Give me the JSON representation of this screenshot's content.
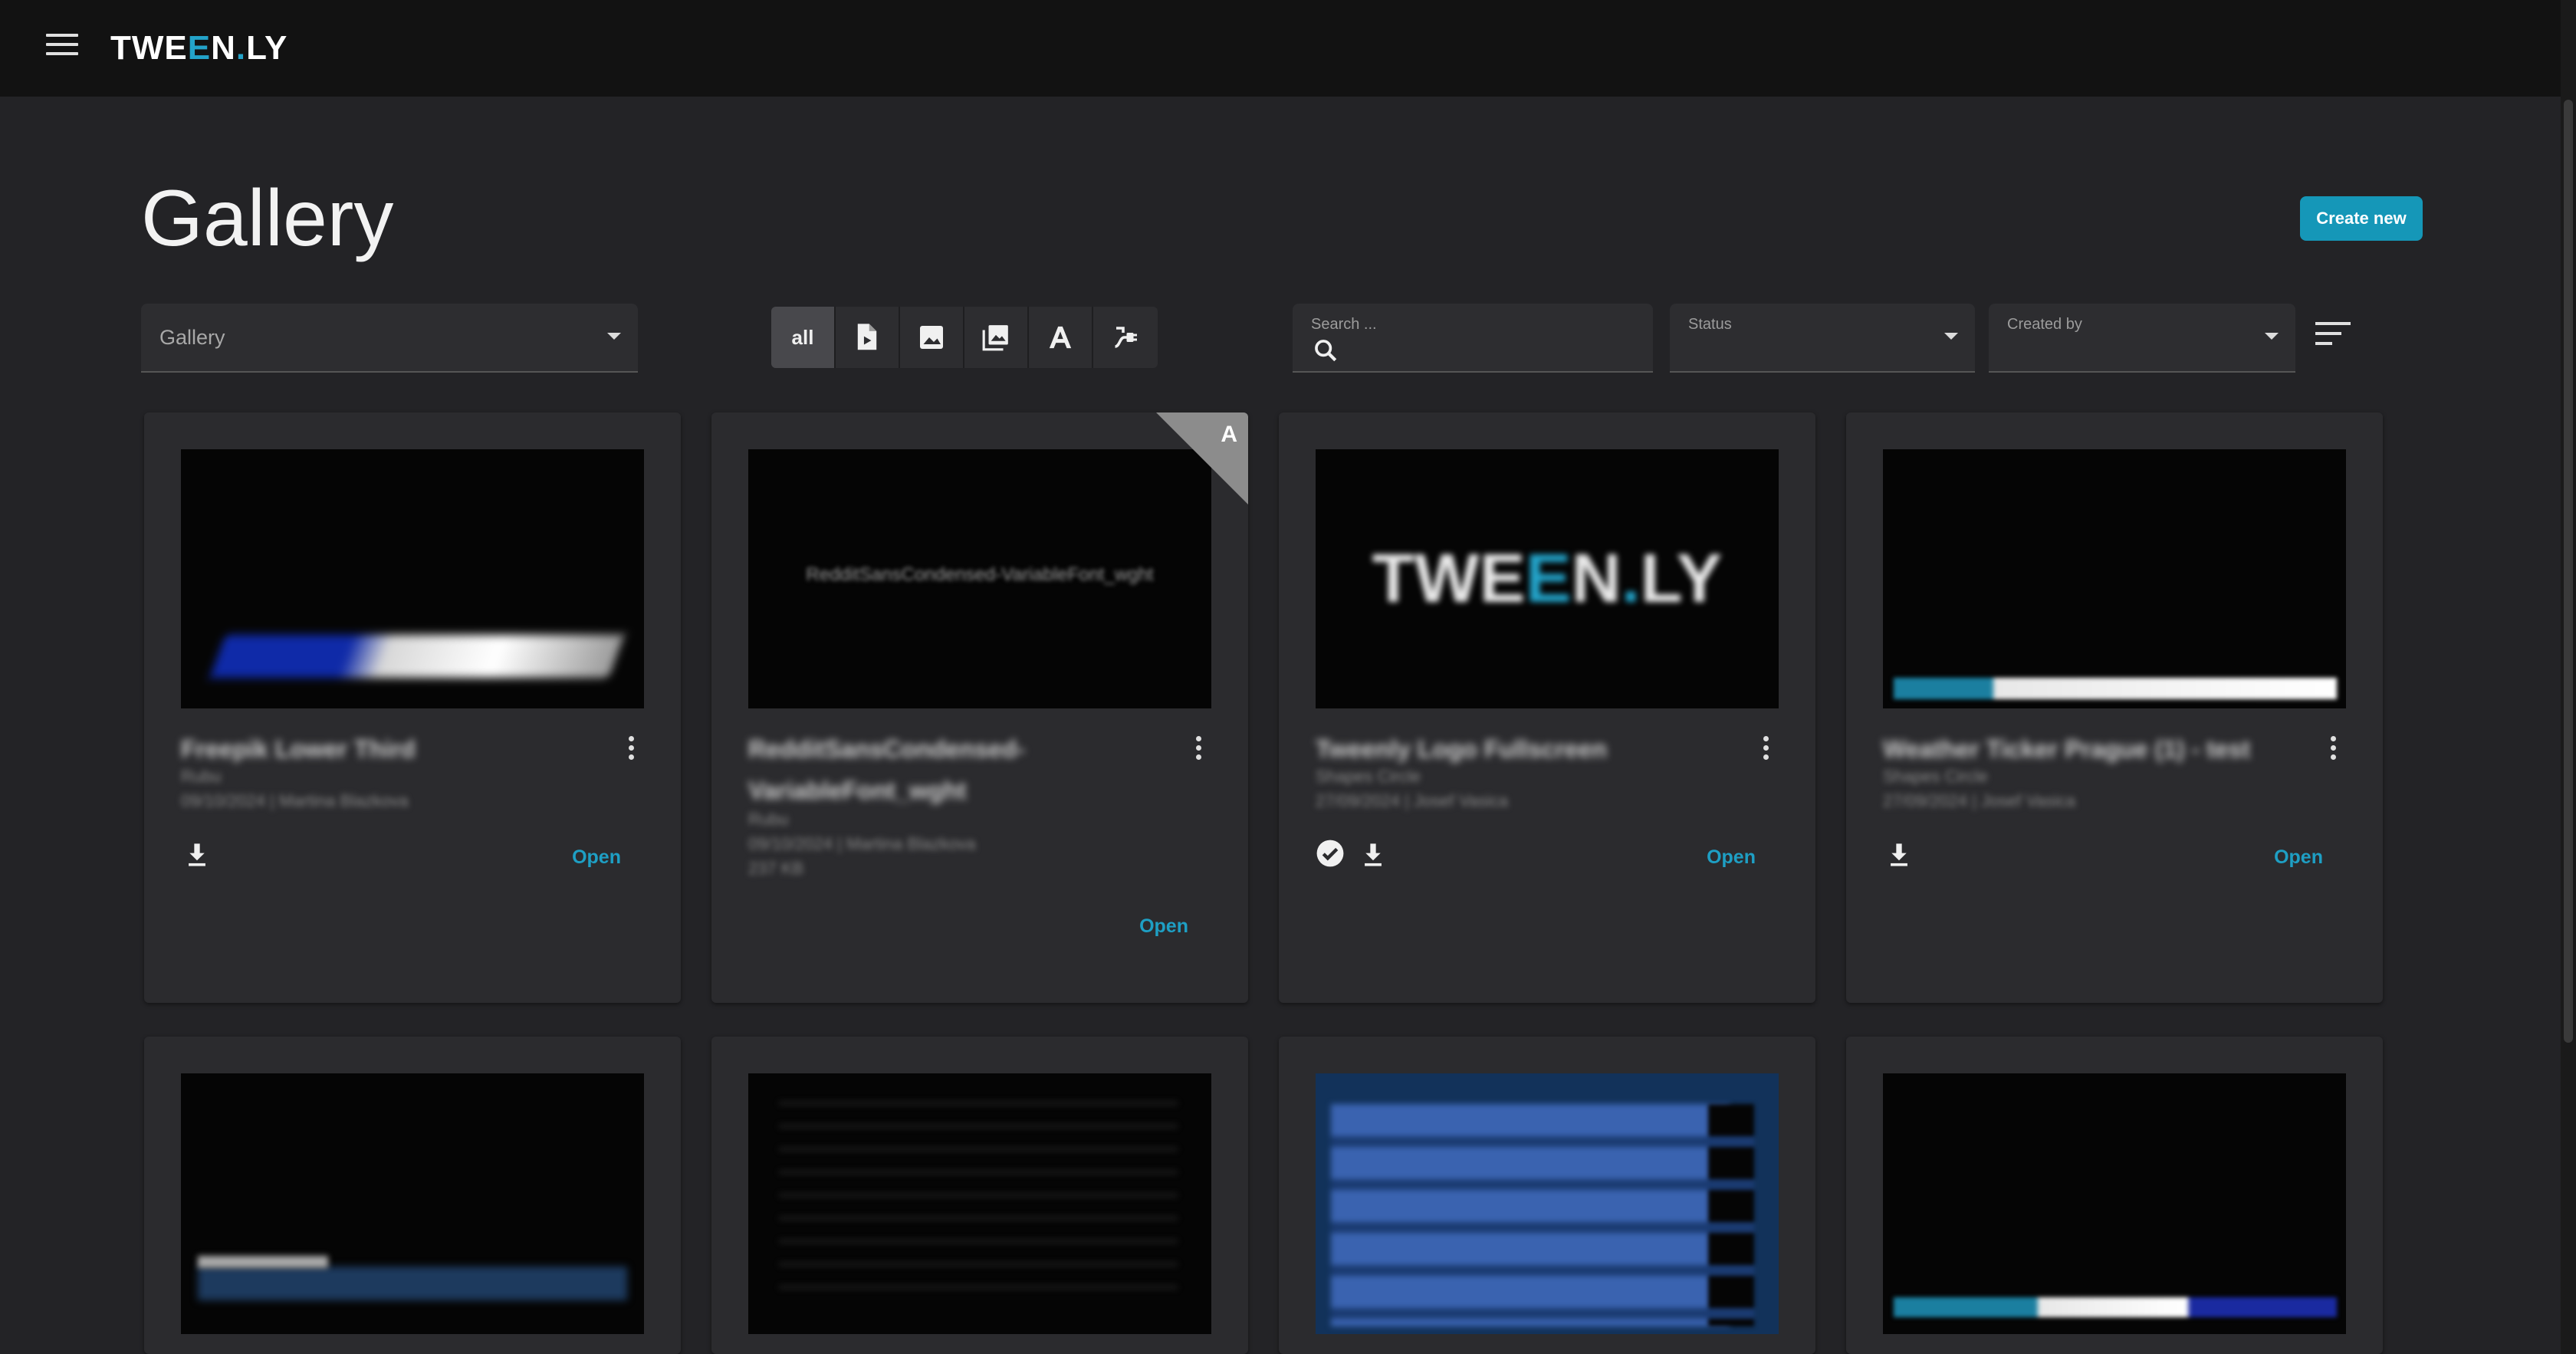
{
  "app": {
    "logo_left": "TWE",
    "logo_accent": "E",
    "logo_mid": "N",
    "logo_dot": ".",
    "logo_right": "LY"
  },
  "page": {
    "title": "Gallery",
    "create_label": "Create new"
  },
  "filters": {
    "gallery_value": "Gallery",
    "type_all_label": "all",
    "type_icons": [
      "file-video-icon",
      "image-icon",
      "image-collection-icon",
      "font-icon",
      "plugin-icon"
    ],
    "search_label": "Search ...",
    "status_label": "Status",
    "created_by_label": "Created by"
  },
  "accent_color": "#1597b8",
  "cards": [
    {
      "title": "Freepik Lower Third",
      "meta1": "Rubu",
      "meta2": "09/10/2024 | Martina Blazkova",
      "open_label": "Open"
    },
    {
      "title": "RedditSansCondensed-VariableFont_wght",
      "meta1": "Rubu",
      "meta2": "09/10/2024 | Martina Blazkova",
      "meta3": "237 KB",
      "thumb_text": "RedditSansCondensed-VariableFont_wght",
      "badge": "A",
      "open_label": "Open"
    },
    {
      "title": "Tweenly Logo Fullscreen",
      "meta1": "Shapes Circle",
      "meta2": "27/09/2024 | Josef Vasica",
      "open_label": "Open"
    },
    {
      "title": "Weather Ticker Prague (1) - test",
      "meta1": "Shapes Circle",
      "meta2": "27/09/2024 | Josef Vasica",
      "open_label": "Open"
    }
  ]
}
